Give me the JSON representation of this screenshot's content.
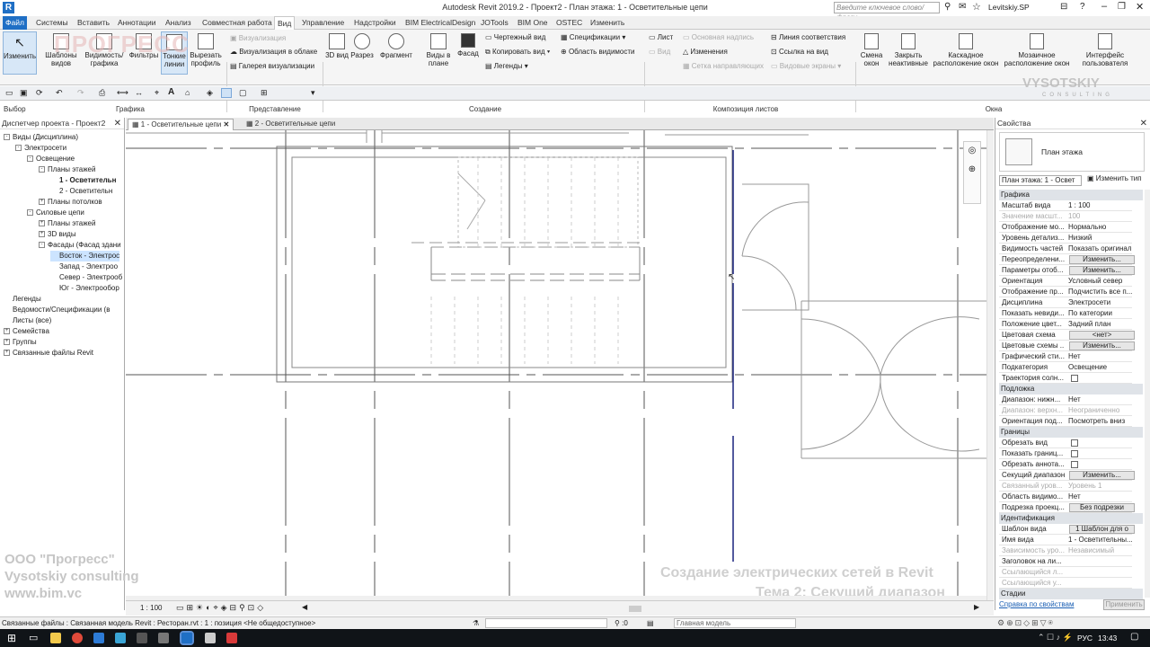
{
  "titlebar": {
    "title": "Autodesk Revit 2019.2 - Проект2 - План этажа: 1 - Осветительные цепи",
    "search_placeholder": "Введите ключевое слово/фразу",
    "user": "Levitskiy.SP"
  },
  "ribbon_tabs": [
    "Файл",
    "Системы",
    "Вставить",
    "Аннотации",
    "Анализ",
    "Совместная работа",
    "Вид",
    "Управление",
    "Надстройки",
    "BIM ElectricalDesign",
    "JOTools",
    "BIM One",
    "OSTEC",
    "Изменить"
  ],
  "ribbon": {
    "modify": "Изменить",
    "select_panel": "Выбор",
    "graphics": [
      "Шаблоны видов",
      "Видимость/ графика",
      "Фильтры",
      "Тонкие линии",
      "Вырезать профиль"
    ],
    "graphics_panel": "Графика",
    "representation": [
      "Визуализация",
      "Визуализация в облаке",
      "Галерея визуализации"
    ],
    "representation_panel": "Представление",
    "create_big": [
      "3D вид",
      "Разрез",
      "Фрагмент",
      "Виды в плане",
      "Фасад"
    ],
    "create_small": [
      "Чертежный вид",
      "Копировать вид",
      "Легенды",
      "Спецификации",
      "Область видимости"
    ],
    "create_panel": "Создание",
    "sheets": [
      "Лист",
      "Вид",
      "Основная надпись",
      "Изменения",
      "Сетка направляющих",
      "Линия соответствия",
      "Ссылка на вид",
      "Видовые экраны"
    ],
    "sheets_panel": "Композиция листов",
    "windows": [
      "Смена окон",
      "Закрыть неактивные",
      "Каскадное расположение окон",
      "Мозаичное расположение окон",
      "Интерфейс пользователя"
    ],
    "windows_panel": "Окна"
  },
  "project_browser": {
    "title": "Диспетчер проекта - Проект2",
    "items": [
      {
        "label": "Виды (Дисциплина)",
        "level": 0,
        "exp": "-"
      },
      {
        "label": "Электросети",
        "level": 1,
        "exp": "-"
      },
      {
        "label": "Освещение",
        "level": 2,
        "exp": "-"
      },
      {
        "label": "Планы этажей",
        "level": 3,
        "exp": "-"
      },
      {
        "label": "1 - Осветительн",
        "level": 4,
        "exp": "",
        "bold": true
      },
      {
        "label": "2 - Осветительн",
        "level": 4,
        "exp": ""
      },
      {
        "label": "Планы потолков",
        "level": 3,
        "exp": "+"
      },
      {
        "label": "Силовые цепи",
        "level": 2,
        "exp": "-"
      },
      {
        "label": "Планы этажей",
        "level": 3,
        "exp": "+"
      },
      {
        "label": "3D виды",
        "level": 3,
        "exp": "+"
      },
      {
        "label": "Фасады (Фасад здани",
        "level": 3,
        "exp": "-"
      },
      {
        "label": "Восток - Электрос",
        "level": 4,
        "exp": "",
        "selected": true
      },
      {
        "label": "Запад - Электроо",
        "level": 4,
        "exp": ""
      },
      {
        "label": "Север - Электрооб",
        "level": 4,
        "exp": ""
      },
      {
        "label": "Юг - Электрообор",
        "level": 4,
        "exp": ""
      },
      {
        "label": "Легенды",
        "level": 0,
        "exp": ""
      },
      {
        "label": "Ведомости/Спецификации (в",
        "level": 0,
        "exp": ""
      },
      {
        "label": "Листы (все)",
        "level": 0,
        "exp": ""
      },
      {
        "label": "Семейства",
        "level": 0,
        "exp": "+"
      },
      {
        "label": "Группы",
        "level": 0,
        "exp": "+"
      },
      {
        "label": "Связанные файлы Revit",
        "level": 0,
        "exp": "+"
      }
    ]
  },
  "doc_tabs": [
    "1 - Осветительные цепи",
    "2 - Осветительные цепи"
  ],
  "properties": {
    "title": "Свойства",
    "type": "План этажа",
    "selector": "План этажа: 1 - Освет",
    "edit_type": "Изменить тип",
    "rows": [
      {
        "s": "Графика"
      },
      {
        "k": "Масштаб вида",
        "v": "1 : 100"
      },
      {
        "k": "Значение масшт...",
        "v": "100",
        "dim": true
      },
      {
        "k": "Отображение мо...",
        "v": "Нормально"
      },
      {
        "k": "Уровень детализ...",
        "v": "Низкий"
      },
      {
        "k": "Видимость частей",
        "v": "Показать оригинал"
      },
      {
        "k": "Переопределени...",
        "v": "Изменить...",
        "btn": true
      },
      {
        "k": "Параметры отоб...",
        "v": "Изменить...",
        "btn": true
      },
      {
        "k": "Ориентация",
        "v": "Условный север"
      },
      {
        "k": "Отображение пр...",
        "v": "Подчистить все п..."
      },
      {
        "k": "Дисциплина",
        "v": "Электросети"
      },
      {
        "k": "Показать невиди...",
        "v": "По категории"
      },
      {
        "k": "Положение цвет...",
        "v": "Задний план"
      },
      {
        "k": "Цветовая схема",
        "v": "<нет>",
        "btn": true
      },
      {
        "k": "Цветовые схемы ...",
        "v": "Изменить...",
        "btn": true
      },
      {
        "k": "Графический сти...",
        "v": "Нет"
      },
      {
        "k": "Подкатегория",
        "v": "Освещение"
      },
      {
        "k": "Траектория солн...",
        "chk": true
      },
      {
        "s": "Подложка"
      },
      {
        "k": "Диапазон: нижн...",
        "v": "Нет"
      },
      {
        "k": "Диапазон: верхн...",
        "v": "Неограниченно",
        "dim": true
      },
      {
        "k": "Ориентация под...",
        "v": "Посмотреть вниз"
      },
      {
        "s": "Границы"
      },
      {
        "k": "Обрезать вид",
        "chk": true
      },
      {
        "k": "Показать границ...",
        "chk": true
      },
      {
        "k": "Обрезать аннота...",
        "chk": true
      },
      {
        "k": "Секущий диапазон",
        "v": "Изменить...",
        "btn": true
      },
      {
        "k": "Связанный уров...",
        "v": "Уровень 1",
        "dim": true
      },
      {
        "k": "Область видимо...",
        "v": "Нет"
      },
      {
        "k": "Подрезка проекц...",
        "v": "Без подрезки",
        "btn": true
      },
      {
        "s": "Идентификация"
      },
      {
        "k": "Шаблон вида",
        "v": "1 Шаблон для о",
        "btn": true
      },
      {
        "k": "Имя вида",
        "v": "1 - Осветительны..."
      },
      {
        "k": "Зависимость уро...",
        "v": "Независимый",
        "dim": true
      },
      {
        "k": "Заголовок на ли...",
        "v": ""
      },
      {
        "k": "Ссылающийся л...",
        "v": "",
        "dim": true
      },
      {
        "k": "Ссылающийся у...",
        "v": "",
        "dim": true
      },
      {
        "s": "Стадии"
      }
    ],
    "help_link": "Справка по свойствам",
    "apply": "Применить"
  },
  "view_bar": {
    "scale": "1 : 100"
  },
  "statusbar": {
    "text": "Связанные файлы : Связанная модель Revit : Ресторан.rvt : 1 : позиция <Не общедоступное>",
    "model": "Главная модель",
    "count": ":0"
  },
  "watermark": {
    "company": "ООО \"Прогресс\"",
    "consulting": "Vysotskiy consulting",
    "site": "www.bim.vc",
    "course": "Создание электрических сетей в Revit",
    "topic": "Тема 2: Секущий диапазон",
    "logo_left": "ПРОГРЕСС",
    "logo_right": "VYSOTSKIY",
    "logo_right_sub": "CONSULTING"
  },
  "taskbar": {
    "lang": "РУС",
    "time": "13:43"
  }
}
